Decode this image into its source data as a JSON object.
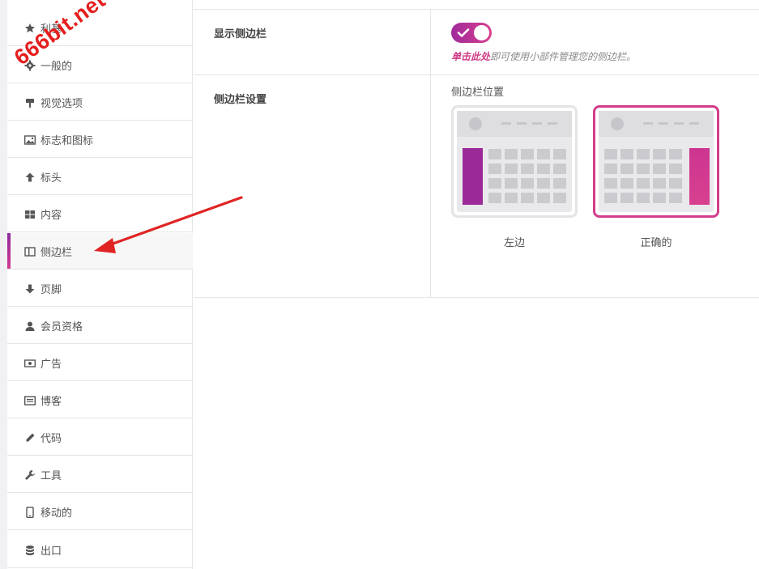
{
  "sidebar": {
    "items": [
      {
        "label": "利基",
        "icon": "star-icon"
      },
      {
        "label": "一般的",
        "icon": "gear-icon"
      },
      {
        "label": "视觉选项",
        "icon": "brush-icon"
      },
      {
        "label": "标志和图标",
        "icon": "image-icon"
      },
      {
        "label": "标头",
        "icon": "arrow-up-icon"
      },
      {
        "label": "内容",
        "icon": "grid-icon"
      },
      {
        "label": "侧边栏",
        "icon": "sidebar-icon",
        "active": true
      },
      {
        "label": "页脚",
        "icon": "arrow-down-icon"
      },
      {
        "label": "会员资格",
        "icon": "user-icon"
      },
      {
        "label": "广告",
        "icon": "money-icon"
      },
      {
        "label": "博客",
        "icon": "list-icon"
      },
      {
        "label": "代码",
        "icon": "pencil-icon"
      },
      {
        "label": "工具",
        "icon": "wrench-icon"
      },
      {
        "label": "移动的",
        "icon": "mobile-icon"
      },
      {
        "label": "出口",
        "icon": "database-icon"
      }
    ]
  },
  "settings": {
    "show_sidebar": {
      "title": "显示侧边栏",
      "enabled": true,
      "help_link": "单击此处",
      "help_text": "即可使用小部件管理您的侧边栏。"
    },
    "sidebar_settings": {
      "title": "侧边栏设置",
      "position_label": "侧边栏位置",
      "options": [
        {
          "label": "左边",
          "selected": false
        },
        {
          "label": "正确的",
          "selected": true
        }
      ]
    }
  },
  "watermark": "666bit.net",
  "colors": {
    "accent_start": "#8e2aa1",
    "accent_end": "#d8408f",
    "annotation_arrow": "#e02424"
  }
}
